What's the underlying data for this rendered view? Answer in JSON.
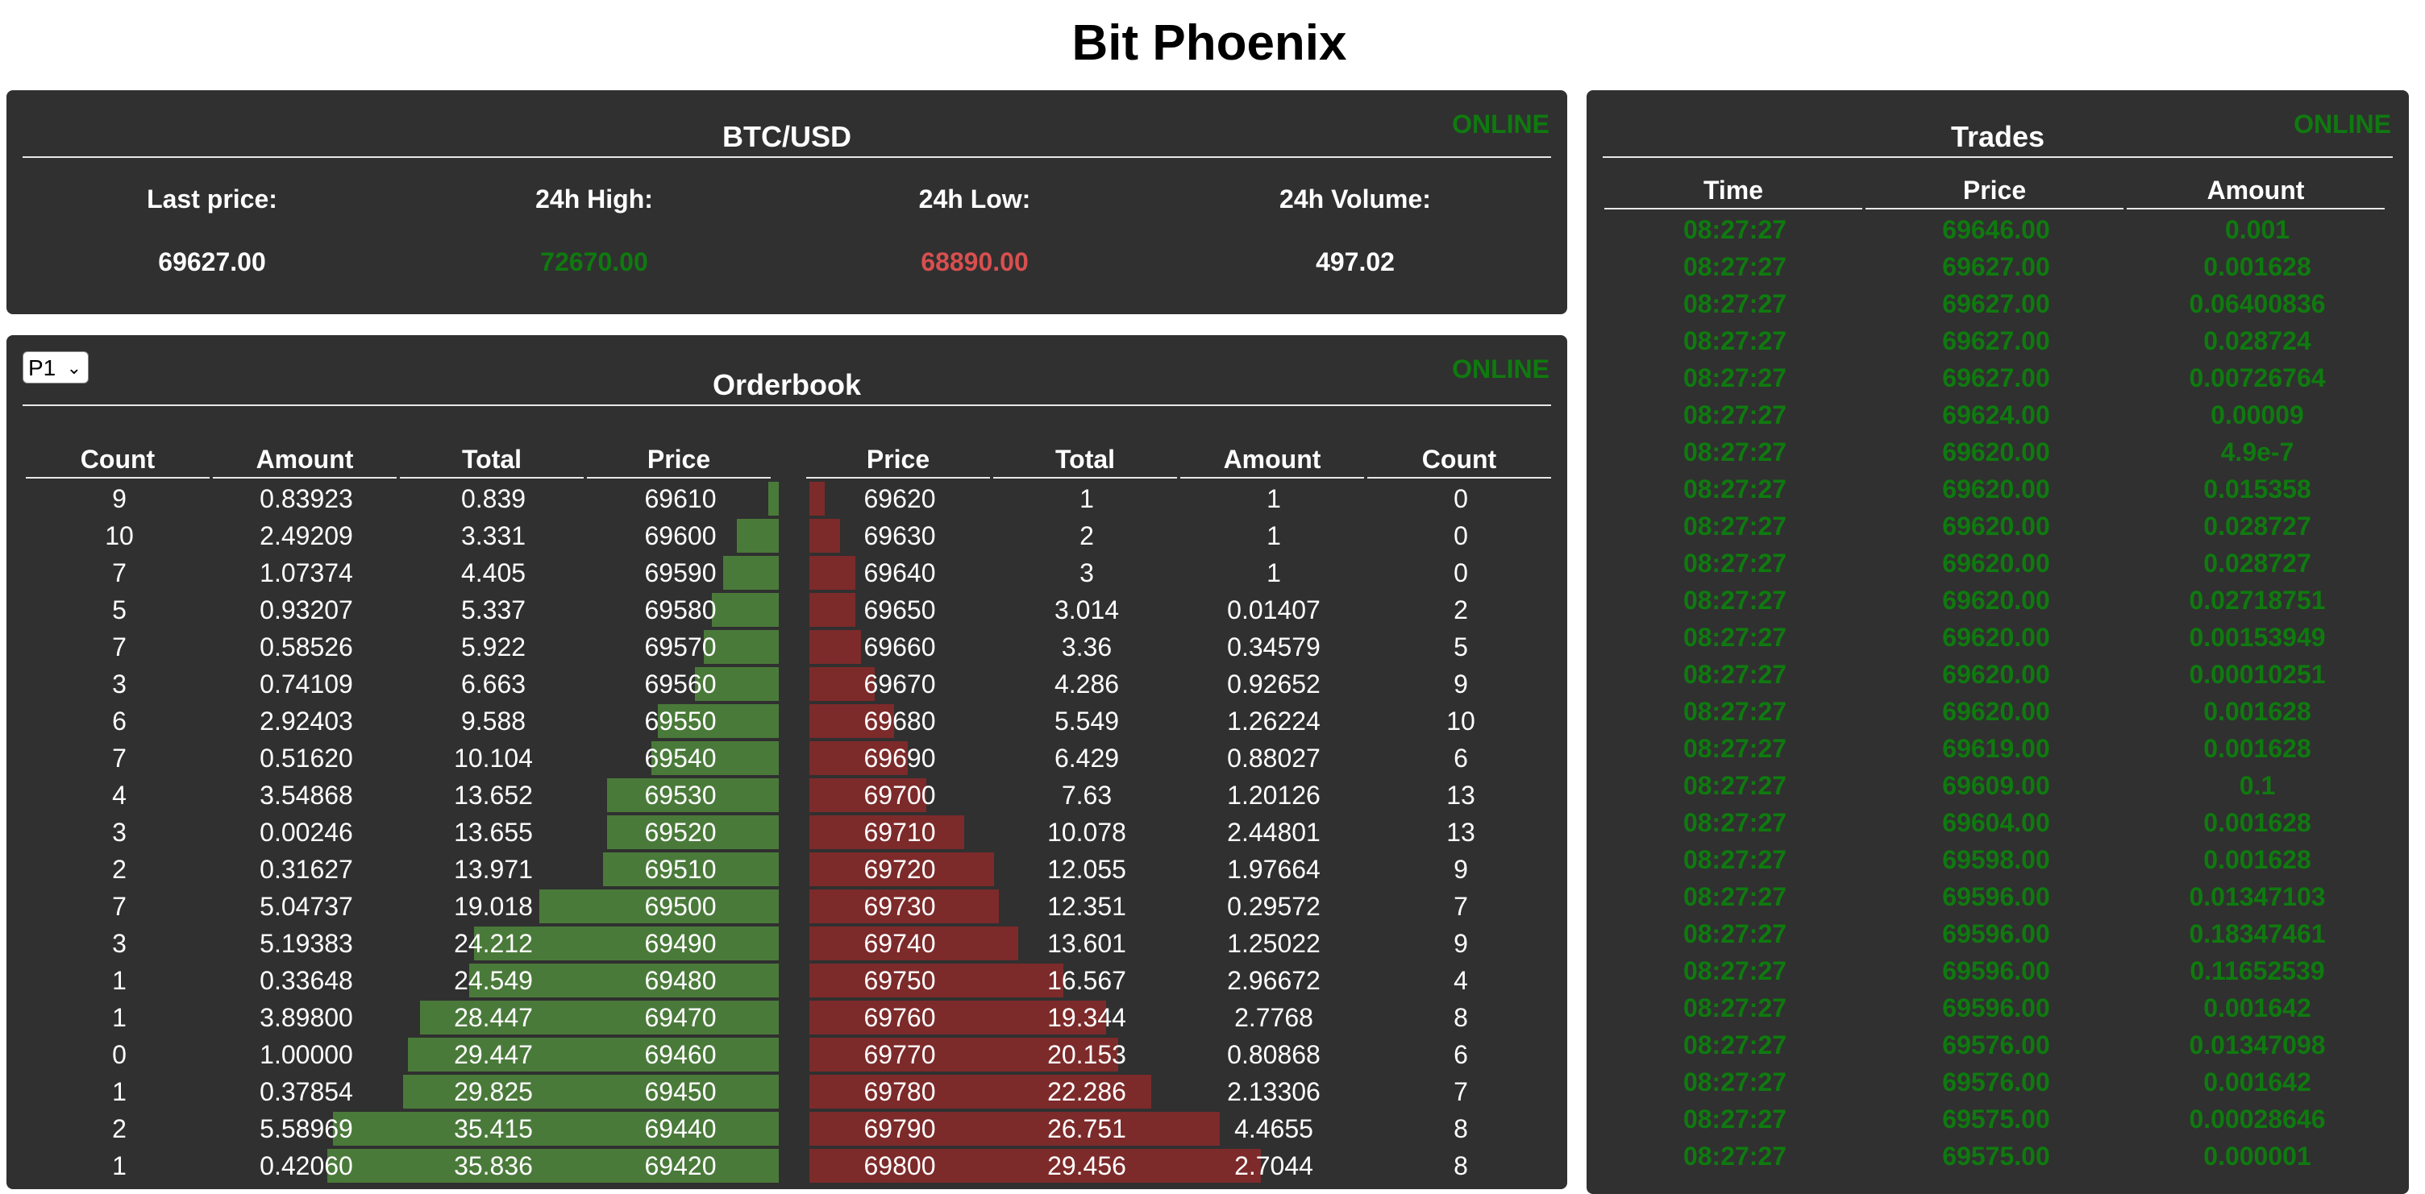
{
  "app": {
    "title": "Bit Phoenix"
  },
  "colors": {
    "panel_bg": "#303030",
    "online": "#0f7a0f",
    "high": "#0f7a0f",
    "low": "#d94f4f",
    "bid_bar": "#4a7a3a",
    "ask_bar": "#7d2a2a"
  },
  "market": {
    "status": "ONLINE",
    "pair": "BTC/USD",
    "stats": [
      {
        "label": "Last price:",
        "value": "69627.00",
        "tone": "neutral"
      },
      {
        "label": "24h High:",
        "value": "72670.00",
        "tone": "high"
      },
      {
        "label": "24h Low:",
        "value": "68890.00",
        "tone": "low"
      },
      {
        "label": "24h Volume:",
        "value": "497.02",
        "tone": "neutral"
      }
    ]
  },
  "orderbook": {
    "title": "Orderbook",
    "status": "ONLINE",
    "precision": "P1",
    "bid_headers": [
      "Count",
      "Amount",
      "Total",
      "Price"
    ],
    "ask_headers": [
      "Price",
      "Total",
      "Amount",
      "Count"
    ],
    "bids": [
      {
        "count": "9",
        "amount": "0.83923",
        "total": "0.839",
        "price": "69610"
      },
      {
        "count": "10",
        "amount": "2.49209",
        "total": "3.331",
        "price": "69600"
      },
      {
        "count": "7",
        "amount": "1.07374",
        "total": "4.405",
        "price": "69590"
      },
      {
        "count": "5",
        "amount": "0.93207",
        "total": "5.337",
        "price": "69580"
      },
      {
        "count": "7",
        "amount": "0.58526",
        "total": "5.922",
        "price": "69570"
      },
      {
        "count": "3",
        "amount": "0.74109",
        "total": "6.663",
        "price": "69560"
      },
      {
        "count": "6",
        "amount": "2.92403",
        "total": "9.588",
        "price": "69550"
      },
      {
        "count": "7",
        "amount": "0.51620",
        "total": "10.104",
        "price": "69540"
      },
      {
        "count": "4",
        "amount": "3.54868",
        "total": "13.652",
        "price": "69530"
      },
      {
        "count": "3",
        "amount": "0.00246",
        "total": "13.655",
        "price": "69520"
      },
      {
        "count": "2",
        "amount": "0.31627",
        "total": "13.971",
        "price": "69510"
      },
      {
        "count": "7",
        "amount": "5.04737",
        "total": "19.018",
        "price": "69500"
      },
      {
        "count": "3",
        "amount": "5.19383",
        "total": "24.212",
        "price": "69490"
      },
      {
        "count": "1",
        "amount": "0.33648",
        "total": "24.549",
        "price": "69480"
      },
      {
        "count": "1",
        "amount": "3.89800",
        "total": "28.447",
        "price": "69470"
      },
      {
        "count": "0",
        "amount": "1.00000",
        "total": "29.447",
        "price": "69460"
      },
      {
        "count": "1",
        "amount": "0.37854",
        "total": "29.825",
        "price": "69450"
      },
      {
        "count": "2",
        "amount": "5.58969",
        "total": "35.415",
        "price": "69440"
      },
      {
        "count": "1",
        "amount": "0.42060",
        "total": "35.836",
        "price": "69420"
      }
    ],
    "asks": [
      {
        "price": "69620",
        "total": "1",
        "amount": "1",
        "count": "0"
      },
      {
        "price": "69630",
        "total": "2",
        "amount": "1",
        "count": "0"
      },
      {
        "price": "69640",
        "total": "3",
        "amount": "1",
        "count": "0"
      },
      {
        "price": "69650",
        "total": "3.014",
        "amount": "0.01407",
        "count": "2"
      },
      {
        "price": "69660",
        "total": "3.36",
        "amount": "0.34579",
        "count": "5"
      },
      {
        "price": "69670",
        "total": "4.286",
        "amount": "0.92652",
        "count": "9"
      },
      {
        "price": "69680",
        "total": "5.549",
        "amount": "1.26224",
        "count": "10"
      },
      {
        "price": "69690",
        "total": "6.429",
        "amount": "0.88027",
        "count": "6"
      },
      {
        "price": "69700",
        "total": "7.63",
        "amount": "1.20126",
        "count": "13"
      },
      {
        "price": "69710",
        "total": "10.078",
        "amount": "2.44801",
        "count": "13"
      },
      {
        "price": "69720",
        "total": "12.055",
        "amount": "1.97664",
        "count": "9"
      },
      {
        "price": "69730",
        "total": "12.351",
        "amount": "0.29572",
        "count": "7"
      },
      {
        "price": "69740",
        "total": "13.601",
        "amount": "1.25022",
        "count": "9"
      },
      {
        "price": "69750",
        "total": "16.567",
        "amount": "2.96672",
        "count": "4"
      },
      {
        "price": "69760",
        "total": "19.344",
        "amount": "2.7768",
        "count": "8"
      },
      {
        "price": "69770",
        "total": "20.153",
        "amount": "0.80868",
        "count": "6"
      },
      {
        "price": "69780",
        "total": "22.286",
        "amount": "2.13306",
        "count": "7"
      },
      {
        "price": "69790",
        "total": "26.751",
        "amount": "4.4655",
        "count": "8"
      },
      {
        "price": "69800",
        "total": "29.456",
        "amount": "2.7044",
        "count": "8"
      }
    ]
  },
  "trades": {
    "title": "Trades",
    "status": "ONLINE",
    "headers": [
      "Time",
      "Price",
      "Amount"
    ],
    "rows": [
      {
        "time": "08:27:27",
        "price": "69646.00",
        "amount": "0.001"
      },
      {
        "time": "08:27:27",
        "price": "69627.00",
        "amount": "0.001628"
      },
      {
        "time": "08:27:27",
        "price": "69627.00",
        "amount": "0.06400836"
      },
      {
        "time": "08:27:27",
        "price": "69627.00",
        "amount": "0.028724"
      },
      {
        "time": "08:27:27",
        "price": "69627.00",
        "amount": "0.00726764"
      },
      {
        "time": "08:27:27",
        "price": "69624.00",
        "amount": "0.00009"
      },
      {
        "time": "08:27:27",
        "price": "69620.00",
        "amount": "4.9e-7"
      },
      {
        "time": "08:27:27",
        "price": "69620.00",
        "amount": "0.015358"
      },
      {
        "time": "08:27:27",
        "price": "69620.00",
        "amount": "0.028727"
      },
      {
        "time": "08:27:27",
        "price": "69620.00",
        "amount": "0.028727"
      },
      {
        "time": "08:27:27",
        "price": "69620.00",
        "amount": "0.02718751"
      },
      {
        "time": "08:27:27",
        "price": "69620.00",
        "amount": "0.00153949"
      },
      {
        "time": "08:27:27",
        "price": "69620.00",
        "amount": "0.00010251"
      },
      {
        "time": "08:27:27",
        "price": "69620.00",
        "amount": "0.001628"
      },
      {
        "time": "08:27:27",
        "price": "69619.00",
        "amount": "0.001628"
      },
      {
        "time": "08:27:27",
        "price": "69609.00",
        "amount": "0.1"
      },
      {
        "time": "08:27:27",
        "price": "69604.00",
        "amount": "0.001628"
      },
      {
        "time": "08:27:27",
        "price": "69598.00",
        "amount": "0.001628"
      },
      {
        "time": "08:27:27",
        "price": "69596.00",
        "amount": "0.01347103"
      },
      {
        "time": "08:27:27",
        "price": "69596.00",
        "amount": "0.18347461"
      },
      {
        "time": "08:27:27",
        "price": "69596.00",
        "amount": "0.11652539"
      },
      {
        "time": "08:27:27",
        "price": "69596.00",
        "amount": "0.001642"
      },
      {
        "time": "08:27:27",
        "price": "69576.00",
        "amount": "0.01347098"
      },
      {
        "time": "08:27:27",
        "price": "69576.00",
        "amount": "0.001642"
      },
      {
        "time": "08:27:27",
        "price": "69575.00",
        "amount": "0.00028646"
      },
      {
        "time": "08:27:27",
        "price": "69575.00",
        "amount": "0.000001"
      }
    ]
  }
}
